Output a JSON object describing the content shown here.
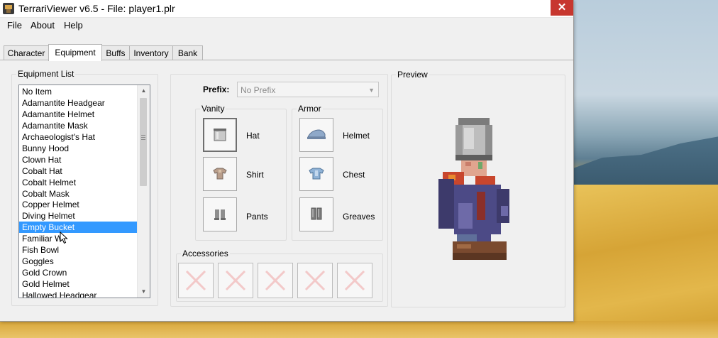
{
  "window": {
    "title": "TerrariViewer v6.5 - File: player1.plr",
    "close_glyph": "✕"
  },
  "menu": [
    "File",
    "About",
    "Help"
  ],
  "tabs": [
    {
      "label": "Character",
      "active": false
    },
    {
      "label": "Equipment",
      "active": true
    },
    {
      "label": "Buffs",
      "active": false
    },
    {
      "label": "Inventory",
      "active": false
    },
    {
      "label": "Bank",
      "active": false
    }
  ],
  "equipment_list": {
    "label": "Equipment List",
    "items": [
      "No Item",
      "Adamantite Headgear",
      "Adamantite Helmet",
      "Adamantite Mask",
      "Archaeologist's Hat",
      "Bunny Hood",
      "Clown Hat",
      "Cobalt Hat",
      "Cobalt Helmet",
      "Cobalt Mask",
      "Copper Helmet",
      "Diving Helmet",
      "Empty Bucket",
      "Familiar W",
      "Fish Bowl",
      "Goggles",
      "Gold Crown",
      "Gold Helmet",
      "Hallowed Headgear"
    ],
    "selected": "Empty Bucket"
  },
  "prefix": {
    "label": "Prefix:",
    "value": "No Prefix"
  },
  "vanity": {
    "label": "Vanity",
    "slots": [
      {
        "label": "Hat",
        "icon": "bucket-icon"
      },
      {
        "label": "Shirt",
        "icon": "shirt-icon"
      },
      {
        "label": "Pants",
        "icon": "pants-icon"
      }
    ]
  },
  "armor": {
    "label": "Armor",
    "slots": [
      {
        "label": "Helmet",
        "icon": "helmet-icon"
      },
      {
        "label": "Chest",
        "icon": "chestplate-icon"
      },
      {
        "label": "Greaves",
        "icon": "greaves-icon"
      }
    ]
  },
  "accessories": {
    "label": "Accessories",
    "slot_icon": "empty-slot-x-icon"
  },
  "preview": {
    "label": "Preview"
  },
  "colors": {
    "selection": "#3399ff",
    "close_button": "#c7372f",
    "empty_slot_x": "#f3c9c9"
  }
}
